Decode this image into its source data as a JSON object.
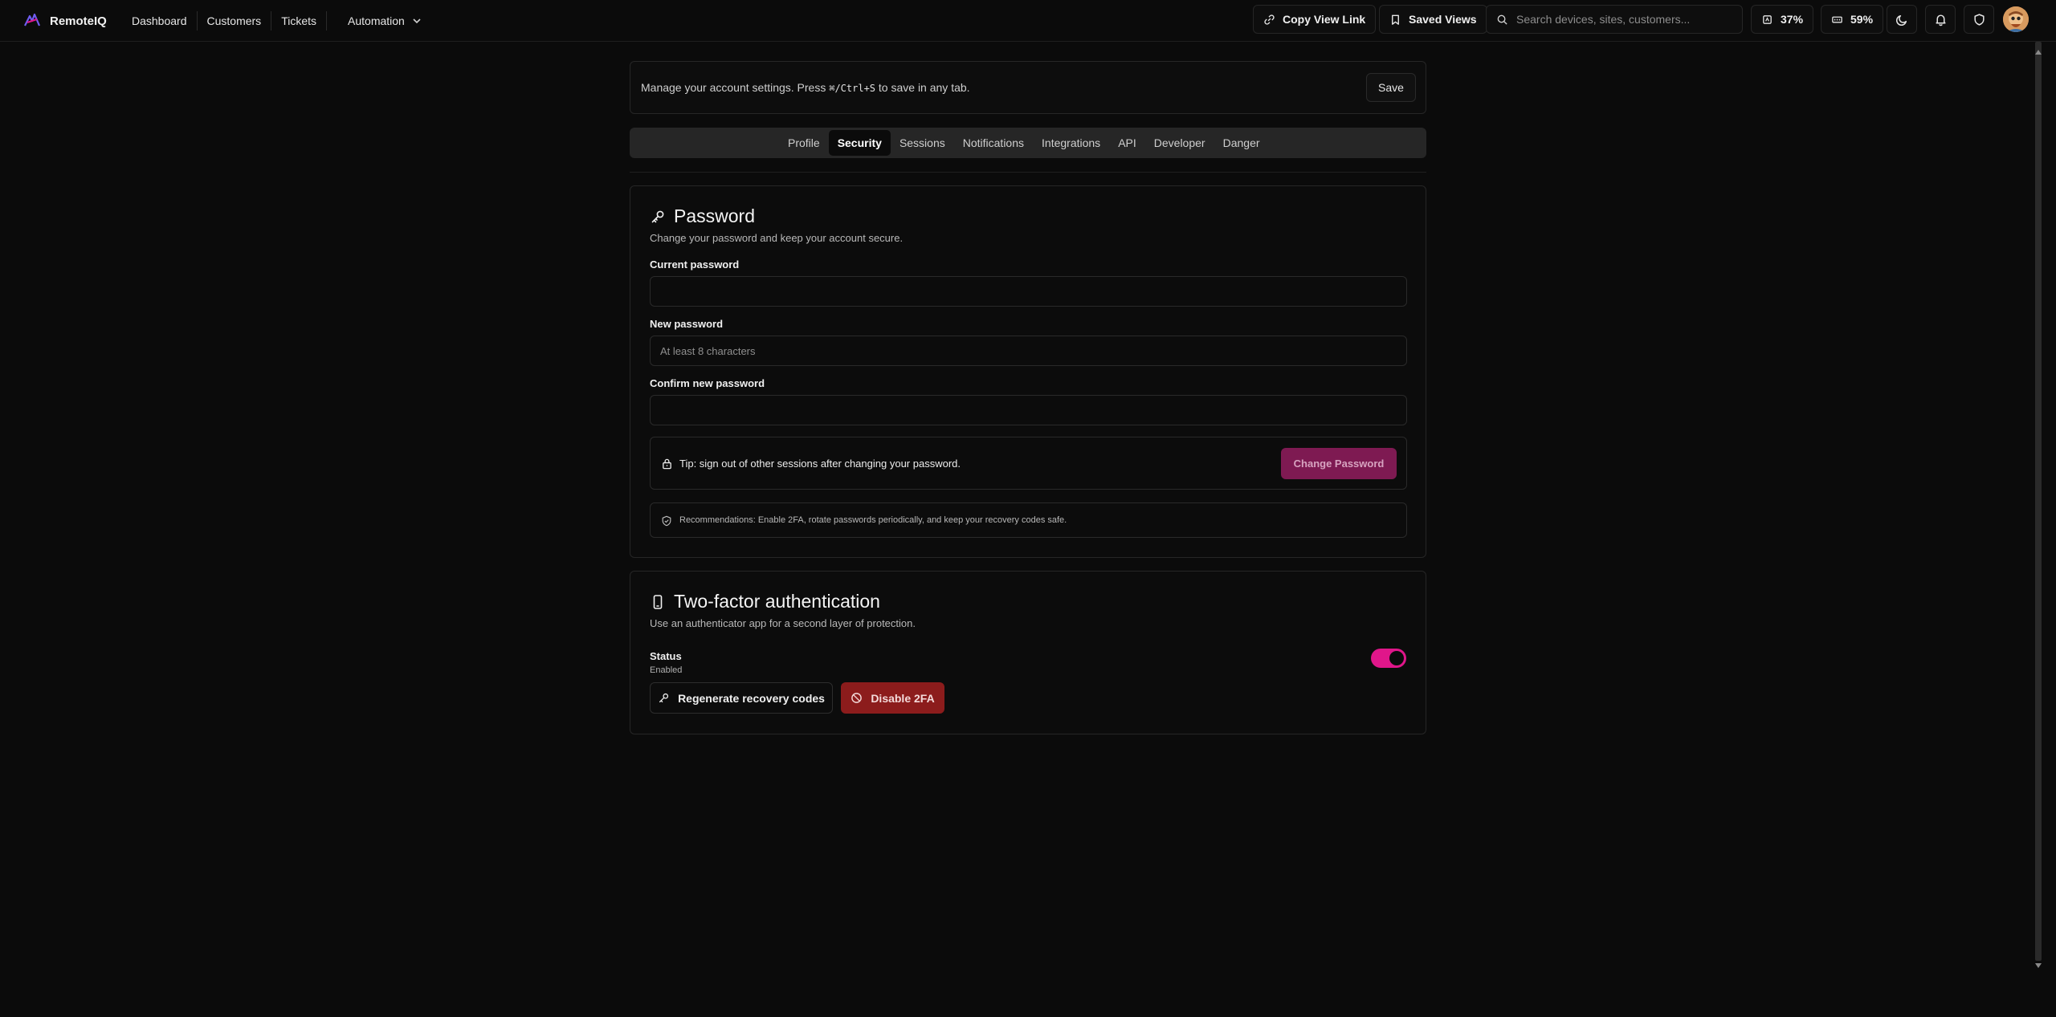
{
  "app": {
    "name": "RemoteIQ"
  },
  "nav": {
    "links": [
      "Dashboard",
      "Customers",
      "Tickets",
      "Automation"
    ]
  },
  "toolbar": {
    "copy_view_link": "Copy View Link",
    "saved_views": "Saved Views",
    "search_placeholder": "Search devices, sites, customers...",
    "cpu_percent": "37%",
    "memory_percent": "59%"
  },
  "settings": {
    "message_before": "Manage your account settings. Press ",
    "shortcut": "⌘/Ctrl+S",
    "message_after": " to save in any tab.",
    "save_label": "Save",
    "tabs": [
      "Profile",
      "Security",
      "Sessions",
      "Notifications",
      "Integrations",
      "API",
      "Developer",
      "Danger"
    ],
    "active_tab": "Security"
  },
  "password_card": {
    "title": "Password",
    "subtitle": "Change your password and keep your account secure.",
    "current_label": "Current password",
    "current_value": "",
    "new_label": "New password",
    "new_placeholder": "At least 8 characters",
    "confirm_label": "Confirm new password",
    "confirm_value": "",
    "tip": "Tip: sign out of other sessions after changing your password.",
    "change_button": "Change Password",
    "recommendations": "Recommendations: Enable 2FA, rotate passwords periodically, and keep your recovery codes safe."
  },
  "twofa_card": {
    "title": "Two-factor authentication",
    "subtitle": "Use an authenticator app for a second layer of protection.",
    "status_label": "Status",
    "status_value": "Enabled",
    "toggle_on": true,
    "regen_button": "Regenerate recovery codes",
    "disable_button": "Disable 2FA"
  },
  "colors": {
    "accent": "#e0168a",
    "change_button_bg": "#7e1a52",
    "danger": "#8c1c1c"
  },
  "icons": [
    "logo-icon",
    "chevron-down-icon",
    "link-icon",
    "bookmark-icon",
    "search-icon",
    "cpu-icon",
    "memory-icon",
    "moon-icon",
    "bell-icon",
    "shield-icon",
    "key-icon",
    "lock-icon",
    "shield-check-icon",
    "smartphone-icon",
    "ban-icon"
  ]
}
